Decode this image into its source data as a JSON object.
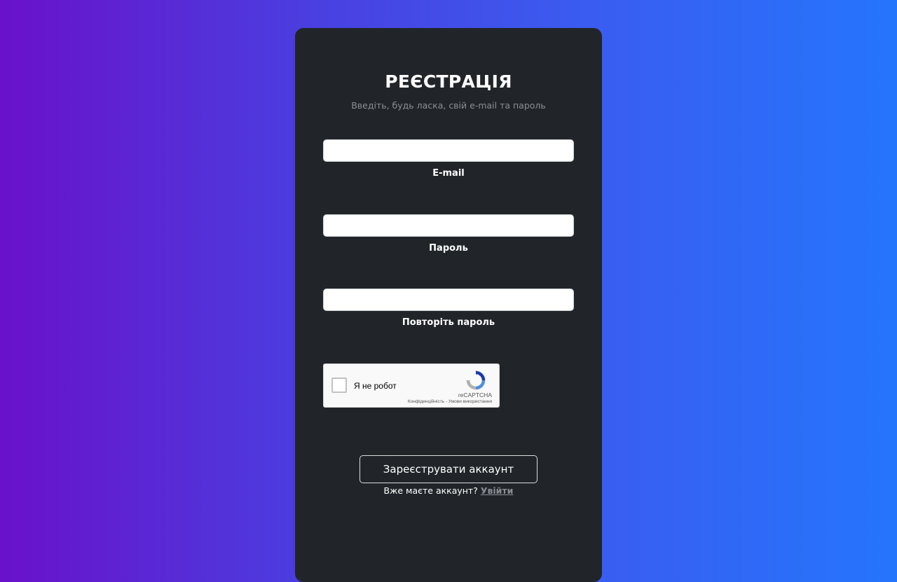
{
  "form": {
    "title": "РЕЄСТРАЦІЯ",
    "subtitle": "Введіть, будь ласка, свій e-mail та пароль",
    "fields": [
      {
        "label": "E-mail",
        "value": "",
        "placeholder": ""
      },
      {
        "label": "Пароль",
        "value": "",
        "placeholder": ""
      },
      {
        "label": "Повторіть пароль",
        "value": "",
        "placeholder": ""
      }
    ]
  },
  "captcha": {
    "label": "Я не робот",
    "brand": "reCAPTCHA",
    "privacy_link": "Конфіденційність",
    "separator": " - ",
    "terms_link": "Умови використання",
    "checked": false
  },
  "actions": {
    "submit_label": "Зареєструвати аккаунт",
    "login_prompt": "Вже маєте аккаунт?",
    "login_link": "Увійти"
  },
  "colors": {
    "gradient_start": "#6a11cb",
    "gradient_end": "#2575fc",
    "card_bg": "#212529",
    "muted_text": "#8a8f96"
  }
}
